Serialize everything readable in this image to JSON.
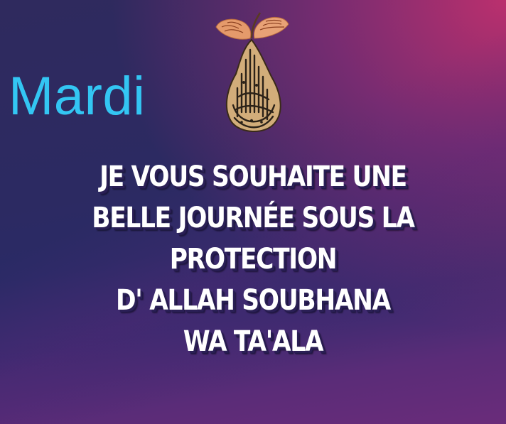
{
  "day_label": "Mardi",
  "message_lines": [
    "JE VOUS SOUHAITE UNE",
    "BELLE JOURNÉE SOUS LA",
    "PROTECTION",
    "D' ALLAH SOUBHANA",
    "WA TA'ALA"
  ],
  "emblem": {
    "icon": "calligraphy-pear-emblem",
    "colors": {
      "leaf": "#e59a6b",
      "body": "#c9a06e",
      "ink": "#2b2218"
    }
  },
  "colors": {
    "day_label": "#33c6f3",
    "message_text": "#ffffff",
    "background_dark": "#2c2a62",
    "background_accent": "#c2306e"
  }
}
